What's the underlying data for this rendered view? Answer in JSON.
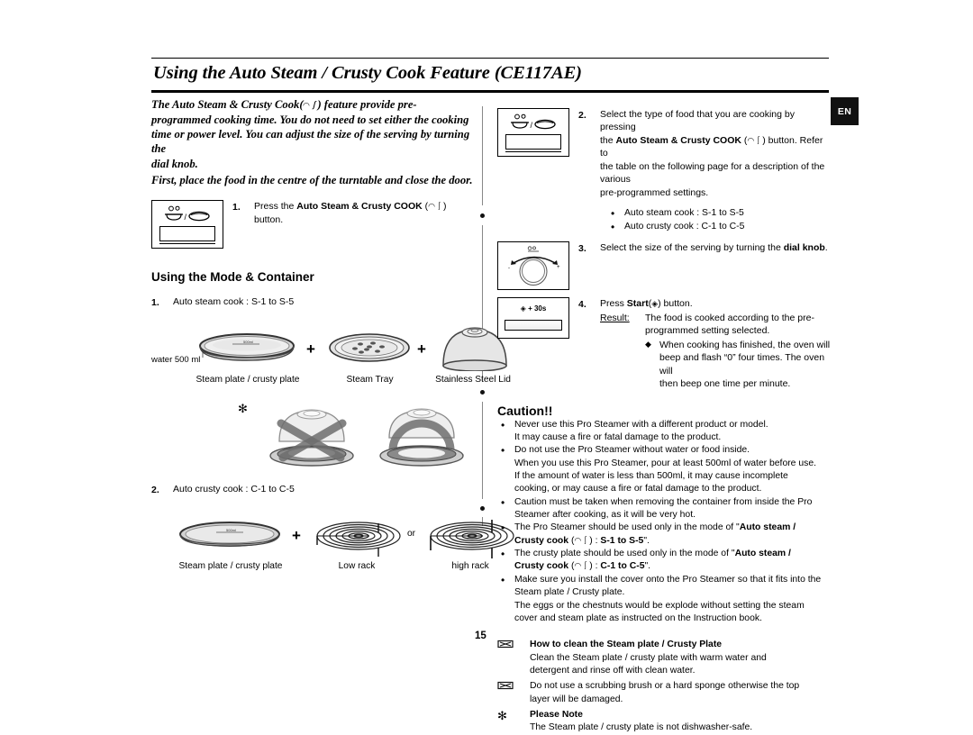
{
  "document": {
    "title": "Using the Auto Steam / Crusty Cook Feature (CE117AE)",
    "language_tab": "EN",
    "page_number": "15"
  },
  "intro": {
    "line1": "The Auto Steam & Crusty Cook(",
    "glyph": "ⓘ",
    "line1b": ") feature provide pre-",
    "line2": "programmed cooking time. You do not need to set either the cooking",
    "line3": "time or power level.  You can adjust the size of the serving by turning the",
    "line4": "dial knob.",
    "line5": "First, place the food in the centre of the turntable and close the door."
  },
  "left_column": {
    "step1": {
      "number": "1.",
      "text_before": "Press the ",
      "text_bold": "Auto Steam & Crusty COOK",
      "text_after": " (     ) button."
    },
    "mode_heading": "Using the Mode & Container",
    "mode1": {
      "number": "1.",
      "label": "Auto steam cook : S-1 to S-5",
      "water_label": "water 500 ml",
      "items": [
        {
          "caption": "Steam plate / crusty plate"
        },
        {
          "caption": "Steam Tray"
        },
        {
          "caption": "Stainless Steel Lid"
        }
      ],
      "plus": "+"
    },
    "mode2": {
      "number": "2.",
      "label": "Auto crusty cook : C-1 to C-5",
      "plus": "+",
      "or": "or",
      "items": [
        {
          "caption": "Steam plate / crusty plate"
        },
        {
          "caption": "Low rack"
        },
        {
          "caption": "high rack"
        }
      ]
    },
    "note_marker": "✻"
  },
  "right_column": {
    "step2": {
      "number": "2.",
      "p1_a": "Select the type of food that you are cooking by pressing",
      "p1_b_pre": "the ",
      "p1_b_bold": "Auto Steam & Crusty COOK",
      "p1_b_post": " (     ) button. Refer to",
      "p1_c": "the table on the following page for a description of the various",
      "p1_d": "pre-programmed settings.",
      "bullets": [
        "Auto steam cook : S-1 to S-5",
        "Auto crusty cook : C-1 to C-5"
      ]
    },
    "step3": {
      "number": "3.",
      "text_a": "Select the size of the serving by turning the ",
      "text_bold": "dial knob",
      "text_b": "."
    },
    "step4": {
      "number": "4.",
      "line_a_pre": "Press ",
      "line_a_bold": "Start",
      "line_a_post": "(      ) button.",
      "result_label": "Result:",
      "result_line1": "The food is cooked according to the pre-",
      "result_line2": "programmed setting selected.",
      "diamond_line1": "When cooking has finished, the oven will",
      "diamond_line2": "beep and flash “0” four times. The oven will",
      "diamond_line3": "then beep one time per minute."
    },
    "start_panel_label": "+ 30s"
  },
  "caution": {
    "heading": "Caution!!",
    "items": [
      {
        "lines": [
          "Never use this Pro Steamer with a different product or model.",
          "It may cause a fire or fatal damage to the product."
        ]
      },
      {
        "lines": [
          "Do not use the Pro Steamer without water or food inside.",
          "When you use this Pro Steamer, pour at least 500ml of water before use.",
          "If the amount of water is less than 500ml, it may cause incomplete",
          "cooking, or may cause a fire or fatal damage to the product."
        ]
      },
      {
        "lines": [
          "Caution must be taken when removing the container from inside the Pro",
          "Steamer after cooking, as it will be very hot."
        ]
      },
      {
        "rich": true,
        "pre": "The Pro Steamer should be used only in the mode of \"",
        "bold1": "Auto steam /",
        "bold2": "Crusty cook",
        "mid": " (     ) : ",
        "bold3": "S-1 to S-5",
        "post": "\"."
      },
      {
        "rich": true,
        "pre": "The crusty plate should be used only in the mode of \"",
        "bold1": "Auto steam /",
        "bold2": "Crusty cook",
        "mid": " (     ) : ",
        "bold3": "C-1 to C-5",
        "post": "\"."
      },
      {
        "lines": [
          "Make sure you install the cover onto the Pro Steamer so that it fits into the",
          "Steam plate / Crusty plate.",
          "The eggs or the chestnuts would be explode without setting the steam",
          "cover and steam plate as instructed on the Instruction book."
        ]
      }
    ]
  },
  "cleaning": {
    "item1": {
      "icon": "steam-plate-icon",
      "title": "How to clean the Steam plate / Crusty Plate",
      "line1": "Clean the Steam plate / crusty plate with warm water and",
      "line2": "detergent and rinse off with clean water."
    },
    "item2": {
      "icon": "steam-plate-icon",
      "line1": "Do not use a scrubbing brush or a hard sponge otherwise the top",
      "line2": "layer will be damaged."
    },
    "item3": {
      "icon": "asterisk-icon",
      "title": "Please Note",
      "line1": "The Steam plate / crusty plate is not dishwasher-safe."
    }
  },
  "colors": {
    "ink": "#000000",
    "tab_bg": "#111111",
    "divider": "#888888"
  }
}
